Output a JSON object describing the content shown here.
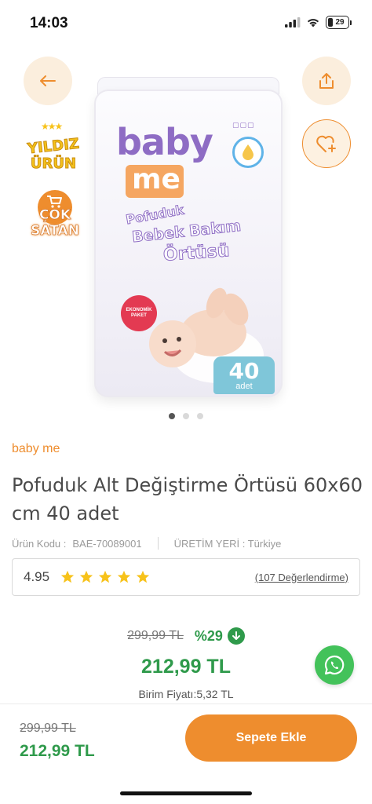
{
  "status_bar": {
    "time": "14:03",
    "battery": "29"
  },
  "gallery": {
    "badge_star": {
      "line1": "YILDIZ",
      "line2": "ÜRÜN"
    },
    "badge_sale": {
      "line1": "ÇOK",
      "line2": "SATAN"
    },
    "package": {
      "brand_top": "baby",
      "brand_bottom": "me",
      "title_1": "Pofuduk",
      "title_2": "Bebek Bakım",
      "title_3": "Örtüsü",
      "eco": "EKONOMİK PAKET",
      "count": "40",
      "count_unit": "adet"
    },
    "dots": [
      true,
      false,
      false
    ]
  },
  "product": {
    "brand": "baby me",
    "title": "Pofuduk Alt Değiştirme Örtüsü 60x60 cm 40 adet",
    "code_label": "Ürün Kodu :",
    "code_value": "BAE-70089001",
    "origin": "ÜRETİM YERİ : Türkiye",
    "rating": "4.95",
    "stars": 5,
    "reviews": "(107 Değerlendirme)"
  },
  "pricing": {
    "old_price": "299,99 TL",
    "discount": "%29",
    "new_price": "212,99 TL",
    "unit_price": "Birim Fiyatı:5,32 TL"
  },
  "bottom_bar": {
    "old_price": "299,99 TL",
    "new_price": "212,99 TL",
    "cta": "Sepete Ekle"
  },
  "colors": {
    "accent": "#ee8d2e",
    "green": "#2f9a4b",
    "star": "#f7c21a",
    "whatsapp": "#43c25a"
  }
}
